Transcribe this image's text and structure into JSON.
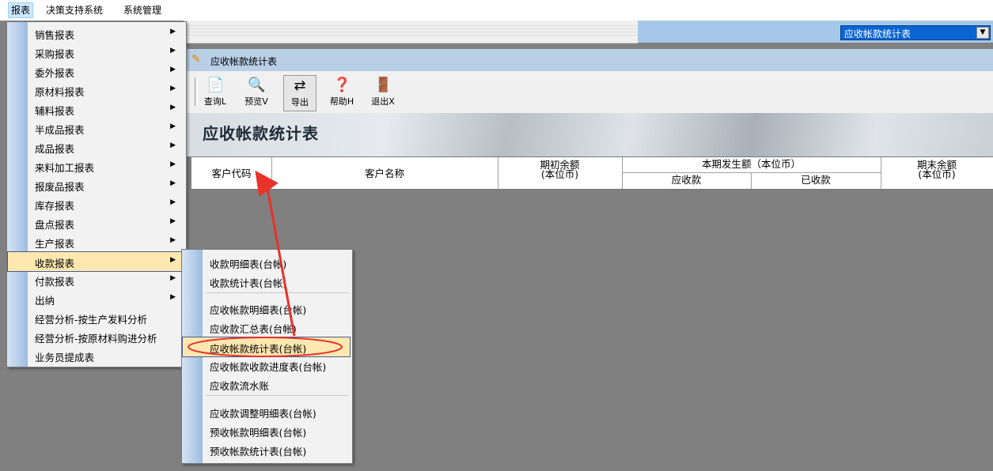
{
  "menubar": {
    "items": [
      "报表",
      "决策支持系统",
      "系统管理"
    ]
  },
  "report_selector": {
    "value": "应收帐款统计表",
    "dropdown_glyph": "▼"
  },
  "window": {
    "title": "应收帐款统计表"
  },
  "toolbar": {
    "buttons": [
      {
        "label": "查询L",
        "icon": "query-icon"
      },
      {
        "label": "预览V",
        "icon": "preview-icon"
      },
      {
        "label": "导出",
        "icon": "export-icon"
      },
      {
        "label": "帮助H",
        "icon": "help-icon"
      },
      {
        "label": "退出X",
        "icon": "exit-icon"
      }
    ]
  },
  "banner": {
    "title": "应收帐款统计表"
  },
  "grid": {
    "headers": {
      "customer_code": "客户代码",
      "customer_name": "客户名称",
      "opening_balance": "期初余额",
      "opening_unit": "(本位币)",
      "period_amount": "本期发生额（本位币）",
      "receivable": "应收款",
      "received": "已收款",
      "closing_balance": "期末余额",
      "closing_unit": "(本位币)"
    }
  },
  "menu": {
    "items": [
      {
        "label": "销售报表",
        "submenu": true
      },
      {
        "label": "采购报表",
        "submenu": true
      },
      {
        "label": "委外报表",
        "submenu": true
      },
      {
        "label": "原材料报表",
        "submenu": true
      },
      {
        "label": "辅料报表",
        "submenu": true
      },
      {
        "label": "半成品报表",
        "submenu": true
      },
      {
        "label": "成品报表",
        "submenu": true
      },
      {
        "label": "来料加工报表",
        "submenu": true
      },
      {
        "label": "报废品报表",
        "submenu": true
      },
      {
        "label": "库存报表",
        "submenu": true
      },
      {
        "label": "盘点报表",
        "submenu": true
      },
      {
        "label": "生产报表",
        "submenu": true
      },
      {
        "label": "收款报表",
        "submenu": true,
        "highlighted": true
      },
      {
        "label": "付款报表",
        "submenu": true
      },
      {
        "label": "出纳",
        "submenu": true
      },
      {
        "label": "经营分析-按生产发料分析",
        "submenu": false
      },
      {
        "label": "经营分析-按原材料购进分析",
        "submenu": false
      },
      {
        "label": "业务员提成表",
        "submenu": false
      }
    ],
    "submenu_arrow": "▶"
  },
  "submenu": {
    "items": [
      {
        "label": "收款明细表(台帐)"
      },
      {
        "label": "收款统计表(台帐)"
      },
      {
        "label": "应收帐款明细表(台帐)"
      },
      {
        "label": "应收款汇总表(台帐)"
      },
      {
        "label": "应收帐款统计表(台帐)",
        "highlighted": true
      },
      {
        "label": "应收帐款收款进度表(台帐)"
      },
      {
        "label": "应收款流水账"
      },
      {
        "label": "应收款调整明细表(台帐)"
      },
      {
        "label": "预收帐款明细表(台帐)"
      },
      {
        "label": "预收帐款统计表(台帐)"
      }
    ]
  },
  "colors": {
    "menu_highlight": "#ffe8b0",
    "annotation_red": "#e8322a",
    "selector_blue": "#0a64d2"
  }
}
